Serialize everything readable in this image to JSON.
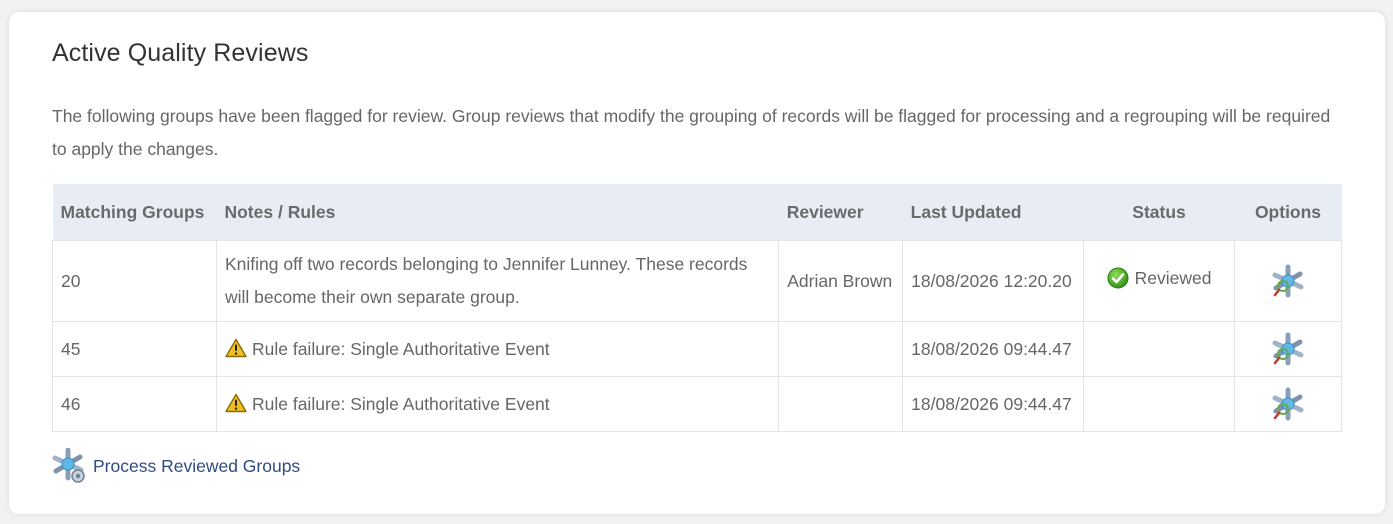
{
  "page": {
    "title": "Active Quality Reviews",
    "intro": "The following groups have been flagged for review. Group reviews that modify the grouping of records will be flagged for processing and a regrouping will be required to apply the changes."
  },
  "table": {
    "headers": {
      "matching_groups": "Matching Groups",
      "notes_rules": "Notes / Rules",
      "reviewer": "Reviewer",
      "last_updated": "Last Updated",
      "status": "Status",
      "options": "Options"
    },
    "rows": [
      {
        "group": "20",
        "note": "Knifing off two records belonging to Jennifer Lunney. These records will become their own separate group.",
        "note_icon": "none",
        "reviewer": "Adrian Brown",
        "last_updated": "18/08/2026 12:20.20",
        "status": "Reviewed",
        "status_icon": "green-check-icon",
        "option_icon": "review-tool-icon"
      },
      {
        "group": "45",
        "note": "Rule failure: Single Authoritative Event",
        "note_icon": "warning-icon",
        "reviewer": "",
        "last_updated": "18/08/2026 09:44.47",
        "status": "",
        "status_icon": "none",
        "option_icon": "review-tool-icon"
      },
      {
        "group": "46",
        "note": "Rule failure: Single Authoritative Event",
        "note_icon": "warning-icon",
        "reviewer": "",
        "last_updated": "18/08/2026 09:44.47",
        "status": "",
        "status_icon": "none",
        "option_icon": "review-tool-icon"
      }
    ]
  },
  "footer": {
    "process_label": "Process Reviewed Groups",
    "process_icon": "process-groups-icon"
  },
  "colors": {
    "header_bg": "#e8edf5",
    "link": "#2f4c87",
    "success": "#3a9a1e",
    "warning": "#f2c01e"
  }
}
